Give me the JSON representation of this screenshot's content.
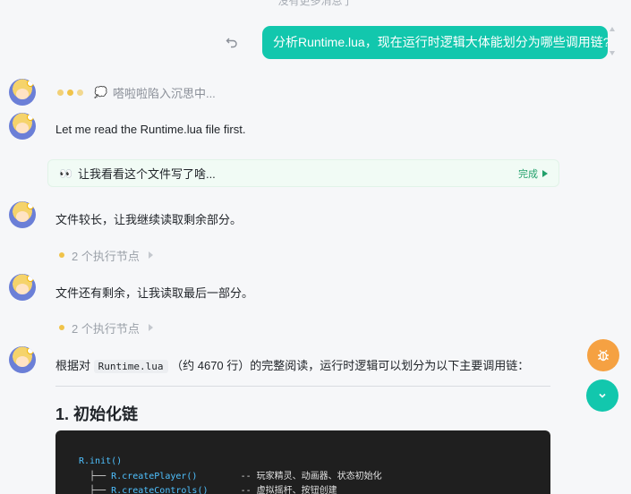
{
  "top_hint": "没有更多消息了",
  "user_message": "分析Runtime.lua，现在运行时逻辑大体能划分为哪些调用链?",
  "thinking_text": "嗒啦啦陷入沉思中...",
  "messages": {
    "m1": "Let me read the Runtime.lua file first.",
    "m2": "文件较长，让我继续读取剩余部分。",
    "m3": "文件还有剩余，让我读取最后一部分。",
    "m4_prefix": "根据对",
    "m4_code": "Runtime.lua",
    "m4_suffix": "（约 4670 行）的完整阅读，运行时逻辑可以划分为以下主要调用链："
  },
  "tool_card": {
    "label": "让我看看这个文件写了啥...",
    "status": "完成"
  },
  "exec_nodes": {
    "node1": "2 个执行节点",
    "node2": "2 个执行节点"
  },
  "section_heading": "1. 初始化链",
  "code_lines": [
    {
      "prefix": "",
      "fn": "R.init()",
      "comment": ""
    },
    {
      "prefix": "  ├── ",
      "fn": "R.createPlayer()",
      "comment": "        -- 玩家精灵、动画器、状态初始化"
    },
    {
      "prefix": "  ├── ",
      "fn": "R.createControls()",
      "comment": "      -- 虚拟摇杆、按钮创建"
    }
  ],
  "icons": {
    "undo": "undo-icon",
    "thinking": "thought-bubble-icon",
    "eyes": "eyes-icon",
    "bug": "bug-icon",
    "scroll_down": "chevron-down-icon"
  },
  "colors": {
    "accent": "#12c7ad",
    "warning": "#f5a142",
    "success": "#22a06b",
    "dot": "#f0c34a"
  }
}
